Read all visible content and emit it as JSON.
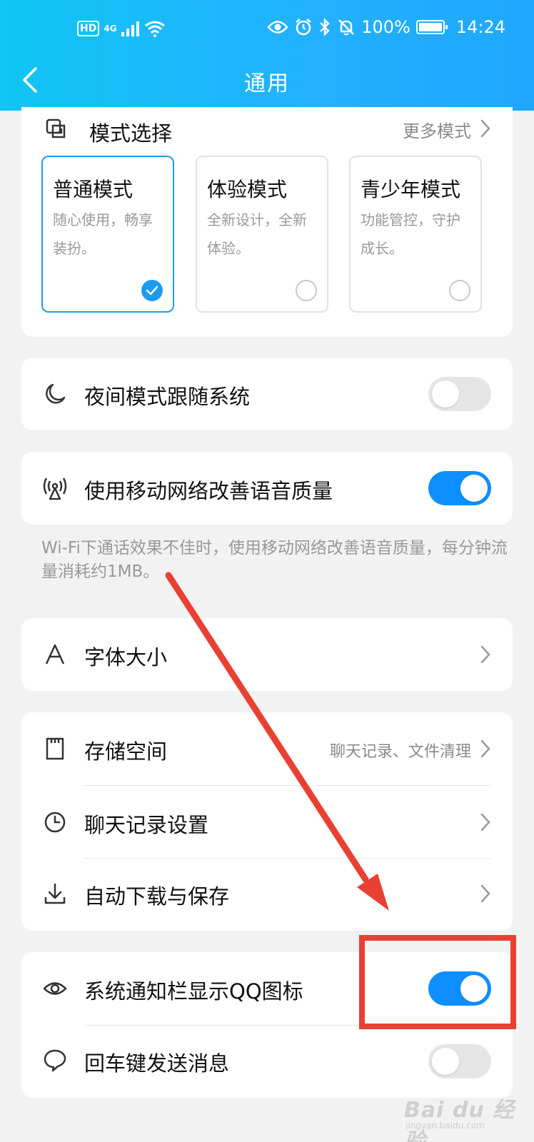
{
  "status_bar": {
    "hd": "HD",
    "network": "4G",
    "battery": "100%",
    "time": "14:24"
  },
  "header": {
    "title": "通用"
  },
  "mode_card": {
    "label": "模式选择",
    "more": "更多模式",
    "modes": [
      {
        "name": "普通模式",
        "desc": "随心使用，畅享装扮。",
        "selected": true
      },
      {
        "name": "体验模式",
        "desc": "全新设计，全新体验。",
        "selected": false
      },
      {
        "name": "青少年模式",
        "desc": "功能管控，守护成长。",
        "selected": false
      }
    ]
  },
  "night_mode": {
    "label": "夜间模式跟随系统",
    "enabled": false
  },
  "mobile_voice": {
    "label": "使用移动网络改善语音质量",
    "enabled": true
  },
  "mobile_voice_hint": "Wi-Fi下通话效果不佳时，使用移动网络改善语音质量，每分钟流量消耗约1MB。",
  "font_size": {
    "label": "字体大小"
  },
  "storage_group": {
    "storage": {
      "label": "存储空间",
      "sub": "聊天记录、文件清理"
    },
    "chat_history": {
      "label": "聊天记录设置"
    },
    "auto_download": {
      "label": "自动下载与保存"
    }
  },
  "notif_group": {
    "qq_icon": {
      "label": "系统通知栏显示QQ图标",
      "enabled": true
    },
    "enter_send": {
      "label": "回车键发送消息",
      "enabled": false
    }
  },
  "annotation_color": "#e84134",
  "accent_color": "#0e8fff",
  "watermark": {
    "logo": "Bai du 经验",
    "url": "jingyan.baidu.com"
  }
}
